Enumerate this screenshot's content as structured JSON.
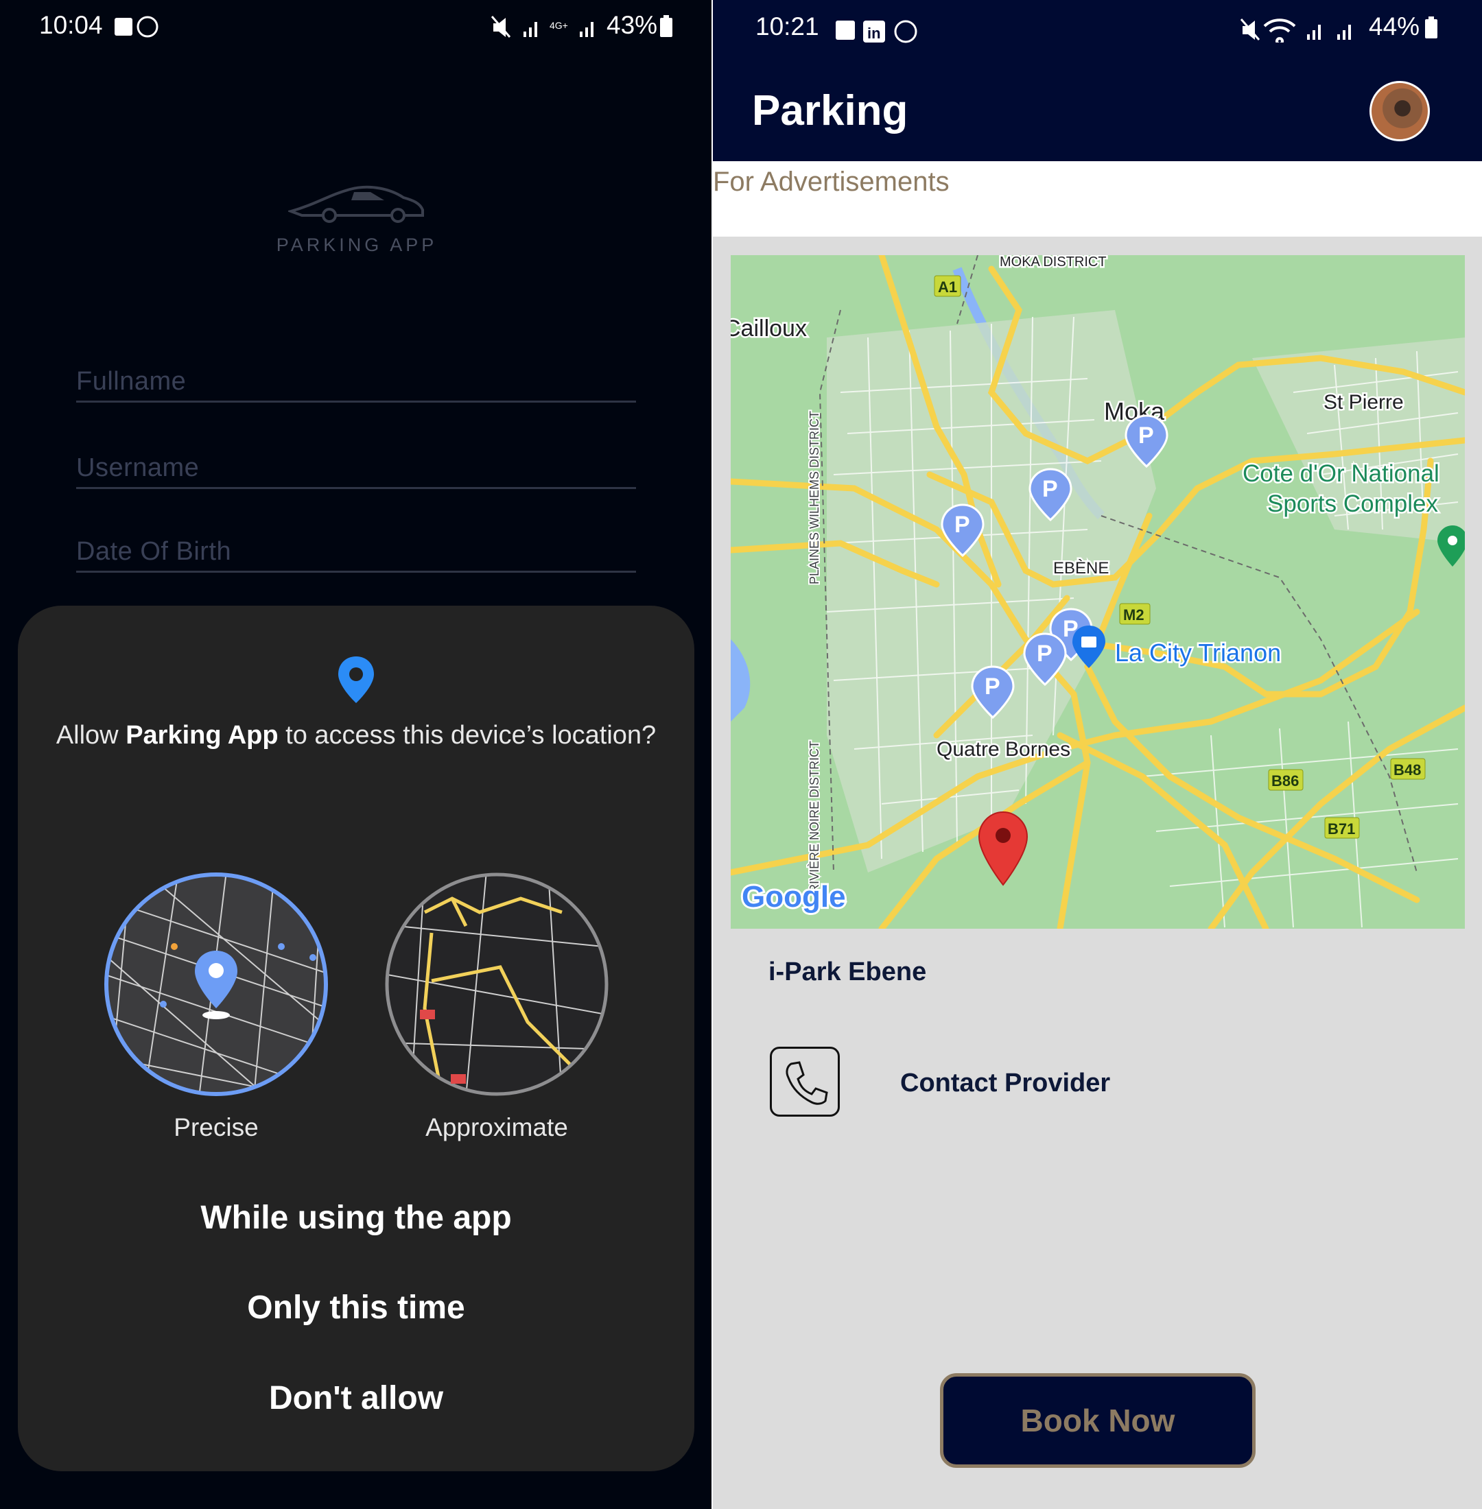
{
  "left_screen": {
    "status_bar": {
      "time": "10:04",
      "battery": "43%",
      "icons": [
        "gallery-icon",
        "whatsapp-icon",
        "mute-icon",
        "signal-icon",
        "4g-icon",
        "signal-icon"
      ]
    },
    "logo_text": "PARKING APP",
    "fields": [
      {
        "placeholder": "Fullname"
      },
      {
        "placeholder": "Username"
      },
      {
        "placeholder": "Date Of Birth"
      }
    ],
    "permission_dialog": {
      "question_prefix": "Allow ",
      "app_name": "Parking App",
      "question_suffix": " to access this device’s location?",
      "options": {
        "precise": "Precise",
        "approximate": "Approximate"
      },
      "buttons": {
        "while_using": "While using the app",
        "only_once": "Only this time",
        "deny": "Don't allow"
      }
    }
  },
  "right_screen": {
    "status_bar": {
      "time": "10:21",
      "battery": "44%",
      "icons": [
        "gallery-icon",
        "linkedin-icon",
        "whatsapp-icon",
        "mute-icon",
        "wifi-icon",
        "signal-icon"
      ]
    },
    "header": {
      "title": "Parking"
    },
    "ad_banner": "For Advertisements",
    "map": {
      "labels": {
        "moka_district": "MOKA DISTRICT",
        "cailloux": "Cailloux",
        "moka": "Moka",
        "st_pierre": "St Pierre",
        "cote_dor_1": "Cote d'Or National",
        "cote_dor_2": "Sports Complex",
        "ebene": "EBÈNE",
        "la_city": "La City Trianon",
        "quatre_bornes": "Quatre Bornes",
        "plaines_wilhems": "PLAINES WILHEMS DISTRICT",
        "riviere_noire": "RIVIÈRE NOIRE DISTRICT",
        "google": "Google"
      },
      "road_shields": [
        "A1",
        "M2",
        "B86",
        "B48",
        "B71"
      ],
      "colors": {
        "land": "#a8d8a3",
        "road": "#f6d24c",
        "parking_pin": "#7d9ff0",
        "selected_pin": "#e53935"
      }
    },
    "lot_name": "i-Park Ebene",
    "contact_label": "Contact Provider",
    "book_button": "Book Now",
    "colors": {
      "navy": "#000a32",
      "gold": "#8d7b62",
      "background": "#dcdcdc"
    }
  }
}
